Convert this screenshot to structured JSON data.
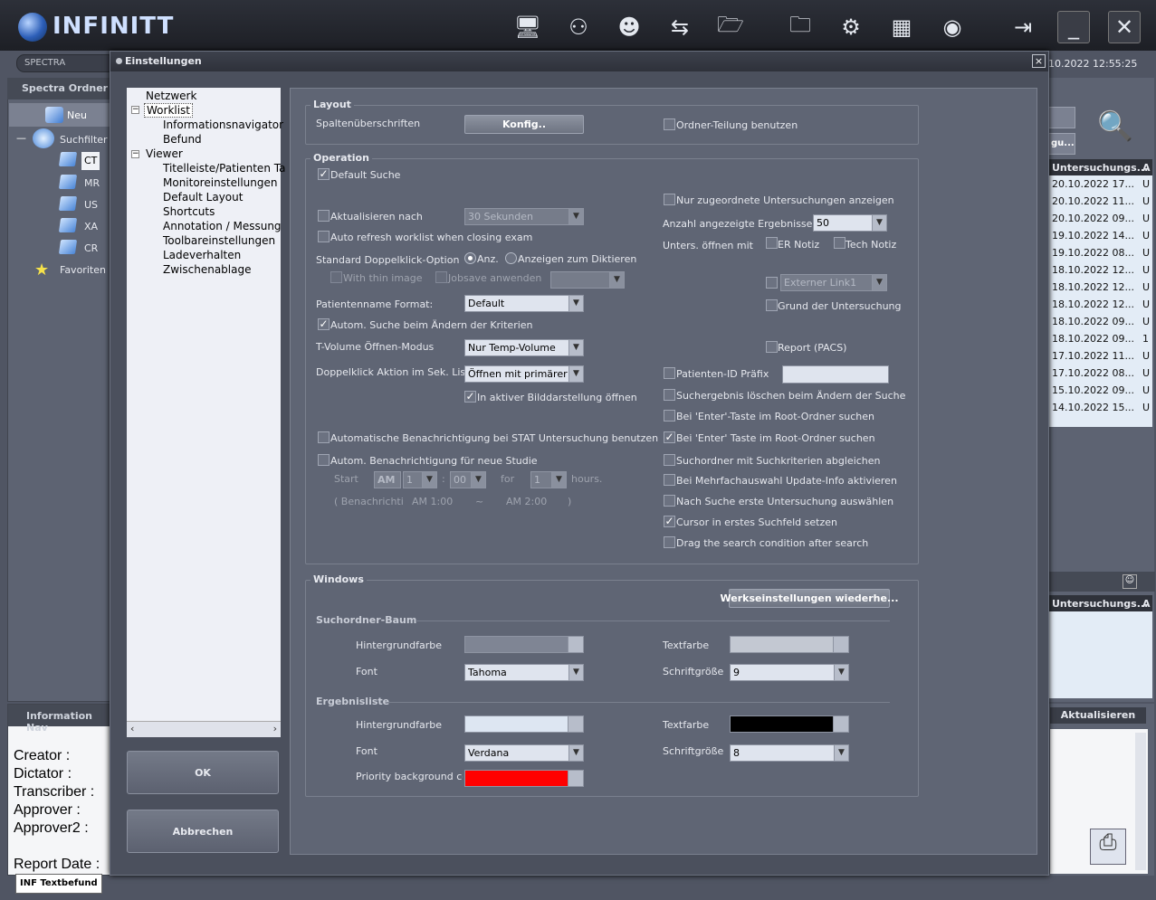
{
  "app": {
    "logo": "INFINITT",
    "search_field": "SPECTRA",
    "datetime": "10.2022 12:55:25"
  },
  "toolbar": [
    "monitor-icon",
    "user-monitor-icon",
    "group-monitor-icon",
    "transfer-icon",
    "open-folder-icon",
    "folder-icon",
    "gear-icon",
    "layout-icon",
    "globe-icon",
    "exit-icon",
    "minimize-icon",
    "close-icon"
  ],
  "left": {
    "title": "Spectra Ordner",
    "items": {
      "neu": "Neu",
      "suchfilter": "Suchfilter",
      "ct": "CT",
      "mr": "MR",
      "us": "US",
      "xa": "XA",
      "cr": "CR",
      "favoriten": "Favoriten"
    },
    "collapse": "—"
  },
  "right": {
    "button2": "gu...",
    "list_header": "Untersuchungs...",
    "header_extra": "A",
    "rows": [
      "20.10.2022 17...",
      "20.10.2022 11...",
      "20.10.2022 09...",
      "19.10.2022 14...",
      "19.10.2022 08...",
      "18.10.2022 12...",
      "18.10.2022 12...",
      "18.10.2022 12...",
      "18.10.2022 09...",
      "18.10.2022 09...",
      "17.10.2022 11...",
      "17.10.2022 08...",
      "15.10.2022 09...",
      "14.10.2022 15..."
    ],
    "rows_extra": [
      "U",
      "U",
      "U",
      "U",
      "U",
      "U",
      "U",
      "U",
      "U",
      "1",
      "U",
      "U",
      "U",
      "U"
    ],
    "list2_header": "Untersuchungs...",
    "aktualisieren": "Aktualisieren"
  },
  "info": {
    "title": "Information Nav",
    "labels": [
      "Creator :",
      "Dictator :",
      "Transcriber :",
      "Approver :",
      "Approver2 :",
      "",
      "Report Date :"
    ],
    "tab": "INF Textbefund"
  },
  "dialog": {
    "title": "Einstellungen",
    "close": "×",
    "nav": {
      "netzwerk": "Netzwerk",
      "worklist": "Worklist",
      "informationsnavigator": "Informationsnavigator",
      "befund": "Befund",
      "viewer": "Viewer",
      "titelleiste": "Titelleiste/Patienten Ta",
      "monitoreinstellungen": "Monitoreinstellungen",
      "default_layout": "Default Layout",
      "shortcuts": "Shortcuts",
      "annotation": "Annotation / Messung",
      "toolbareinstellungen": "Toolbareinstellungen",
      "ladeverhalten": "Ladeverhalten",
      "zwischenablage": "Zwischenablage",
      "minus": "−"
    },
    "ok": "OK",
    "cancel": "Abbrechen",
    "layout": {
      "title": "Layout",
      "spalten": "Spaltenüberschriften",
      "konfig": "Konfig..",
      "ordner_teilung": "Ordner-Teilung benutzen"
    },
    "operation": {
      "title": "Operation",
      "default_suche": "Default Suche",
      "aktualisieren_nach": "Aktualisieren nach",
      "aktualisieren_value": "30 Sekunden",
      "auto_refresh": "Auto refresh worklist when closing exam",
      "doppelklick_option": "Standard Doppelklick-Option",
      "anz": "Anz.",
      "anzeigen_diktieren": "Anzeigen zum Diktieren",
      "thin_image": "With thin image",
      "jobsave": "Jobsave anwenden",
      "patientenname_format": "Patientenname Format:",
      "patientenname_value": "Default",
      "autom_suche": "Autom. Suche beim Ändern der Kriterien",
      "tvolume": "T-Volume Öffnen-Modus",
      "tvolume_value": "Nur Temp-Volume",
      "doppelklick_aktion": "Doppelklick Aktion im Sek. Liste",
      "doppelklick_value": "Öffnen mit primärer ...",
      "in_aktiver": "In aktiver Bilddarstellung öffnen",
      "stat": "Automatische Benachrichtigung bei STAT Untersuchung benutzen",
      "neue_studie": "Autom. Benachrichtigung für neue Studie",
      "start": "Start",
      "am": "AM",
      "hour": "1",
      "colon": ":",
      "minute": "00",
      "for": "for",
      "for_value": "1",
      "hours": "hours.",
      "benachrichtigung": "( Benachrichtigu",
      "am100": "AM 1:00",
      "tilde": "~",
      "am200": "AM 2:00",
      "close_paren": ")",
      "nur_zugeordnete": "Nur zugeordnete Untersuchungen anzeigen",
      "anzahl": "Anzahl angezeigte Ergebnisse",
      "anzahl_value": "50",
      "unters_oeffnen": "Unters. öffnen mit",
      "er_notiz": "ER Notiz",
      "tech_notiz": "Tech Notiz",
      "externer_link": "Externer Link1",
      "grund": "Grund der Untersuchung",
      "report_pacs": "Report (PACS)",
      "patienten_id": "Patienten-ID Präfix",
      "sucherg_loeschen": "Suchergebnis löschen beim Ändern der Suche",
      "enter_root1": "Bei 'Enter'-Taste im Root-Ordner suchen",
      "enter_root2": "Bei 'Enter' Taste im Root-Ordner suchen",
      "suchordner_abgleichen": "Suchordner mit Suchkriterien abgleichen",
      "mehrfachauswahl": "Bei Mehrfachauswahl Update-Info aktivieren",
      "erste_untersuchung": "Nach Suche erste Untersuchung auswählen",
      "cursor": "Cursor in erstes Suchfeld setzen",
      "drag": "Drag the search condition after search"
    },
    "windows": {
      "title": "Windows",
      "werkseinstellungen": "Werkseinstellungen wiederhe...",
      "suchordner_baum": "Suchordner-Baum",
      "hintergrundfarbe": "Hintergrundfarbe",
      "font": "Font",
      "textfarbe": "Textfarbe",
      "schriftgroesse": "Schriftgröße",
      "tree_font": "Tahoma",
      "tree_size": "9",
      "ergebnisliste": "Ergebnisliste",
      "list_font": "Verdana",
      "list_size": "8",
      "priority": "Priority background color",
      "colors": {
        "tree_bg": "#7f8594",
        "tree_text": "#c3c8d2",
        "list_bg": "#dde6f2",
        "list_text": "#000000",
        "priority": "#ff0000"
      }
    }
  }
}
